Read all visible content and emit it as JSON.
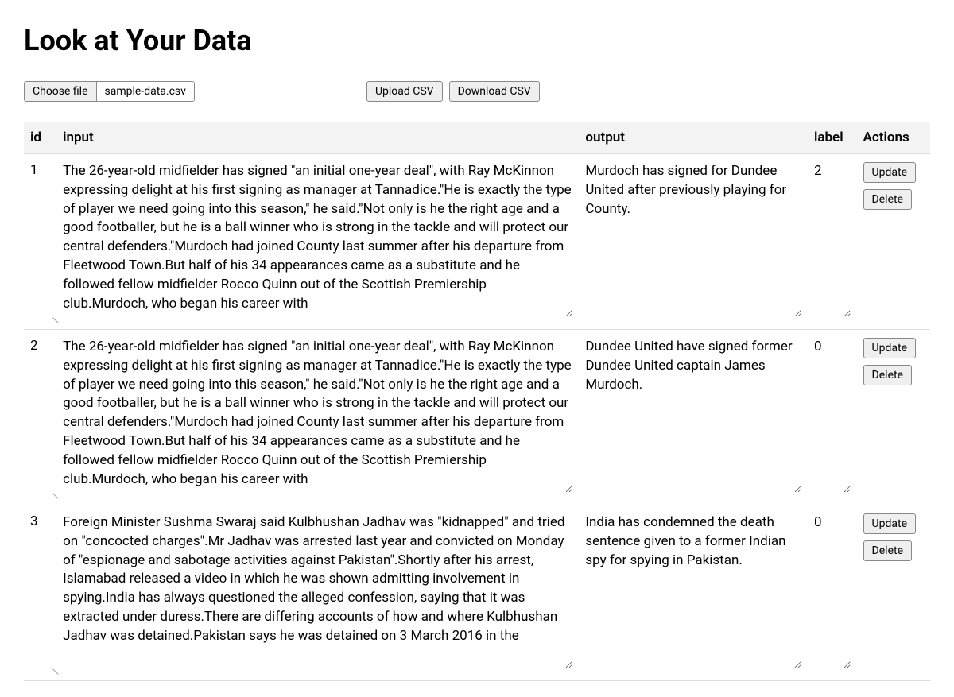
{
  "title": "Look at Your Data",
  "toolbar": {
    "choose_file_label": "Choose file",
    "filename": "sample-data.csv",
    "upload_label": "Upload CSV",
    "download_label": "Download CSV"
  },
  "columns": {
    "id": "id",
    "input": "input",
    "output": "output",
    "label": "label",
    "actions": "Actions"
  },
  "actions": {
    "update": "Update",
    "delete": "Delete"
  },
  "rows": [
    {
      "id": "1",
      "input": "The 26-year-old midfielder has signed \"an initial one-year deal\", with Ray McKinnon expressing delight at his first signing as manager at Tannadice.\"He is exactly the type of player we need going into this season,\" he said.\"Not only is he the right age and a good footballer, but he is a ball winner who is strong in the tackle and will protect our central defenders.\"Murdoch had joined County last summer after his departure from Fleetwood Town.But half of his 34 appearances came as a substitute and he followed fellow midfielder Rocco Quinn out of the Scottish Premiership club.Murdoch, who began his career with",
      "output": "Murdoch has signed for Dundee United after previously playing for County.",
      "label": "2"
    },
    {
      "id": "2",
      "input": "The 26-year-old midfielder has signed \"an initial one-year deal\", with Ray McKinnon expressing delight at his first signing as manager at Tannadice.\"He is exactly the type of player we need going into this season,\" he said.\"Not only is he the right age and a good footballer, but he is a ball winner who is strong in the tackle and will protect our central defenders.\"Murdoch had joined County last summer after his departure from Fleetwood Town.But half of his 34 appearances came as a substitute and he followed fellow midfielder Rocco Quinn out of the Scottish Premiership club.Murdoch, who began his career with",
      "output": "Dundee United have signed former Dundee United captain James Murdoch.",
      "label": "0"
    },
    {
      "id": "3",
      "input": "Foreign Minister Sushma Swaraj said Kulbhushan Jadhav was \"kidnapped\" and tried on \"concocted charges\".Mr Jadhav was arrested last year and convicted on Monday of \"espionage and sabotage activities against Pakistan\".Shortly after his arrest, Islamabad released a video in which he was shown admitting involvement in spying.India has always questioned the alleged confession, saying that it was extracted under duress.There are differing accounts of how and where Kulbhushan Jadhav was detained.Pakistan says he was detained on 3 March 2016 in the",
      "output": "India has condemned the death sentence given to a former Indian spy for spying in Pakistan.",
      "label": "0"
    }
  ]
}
